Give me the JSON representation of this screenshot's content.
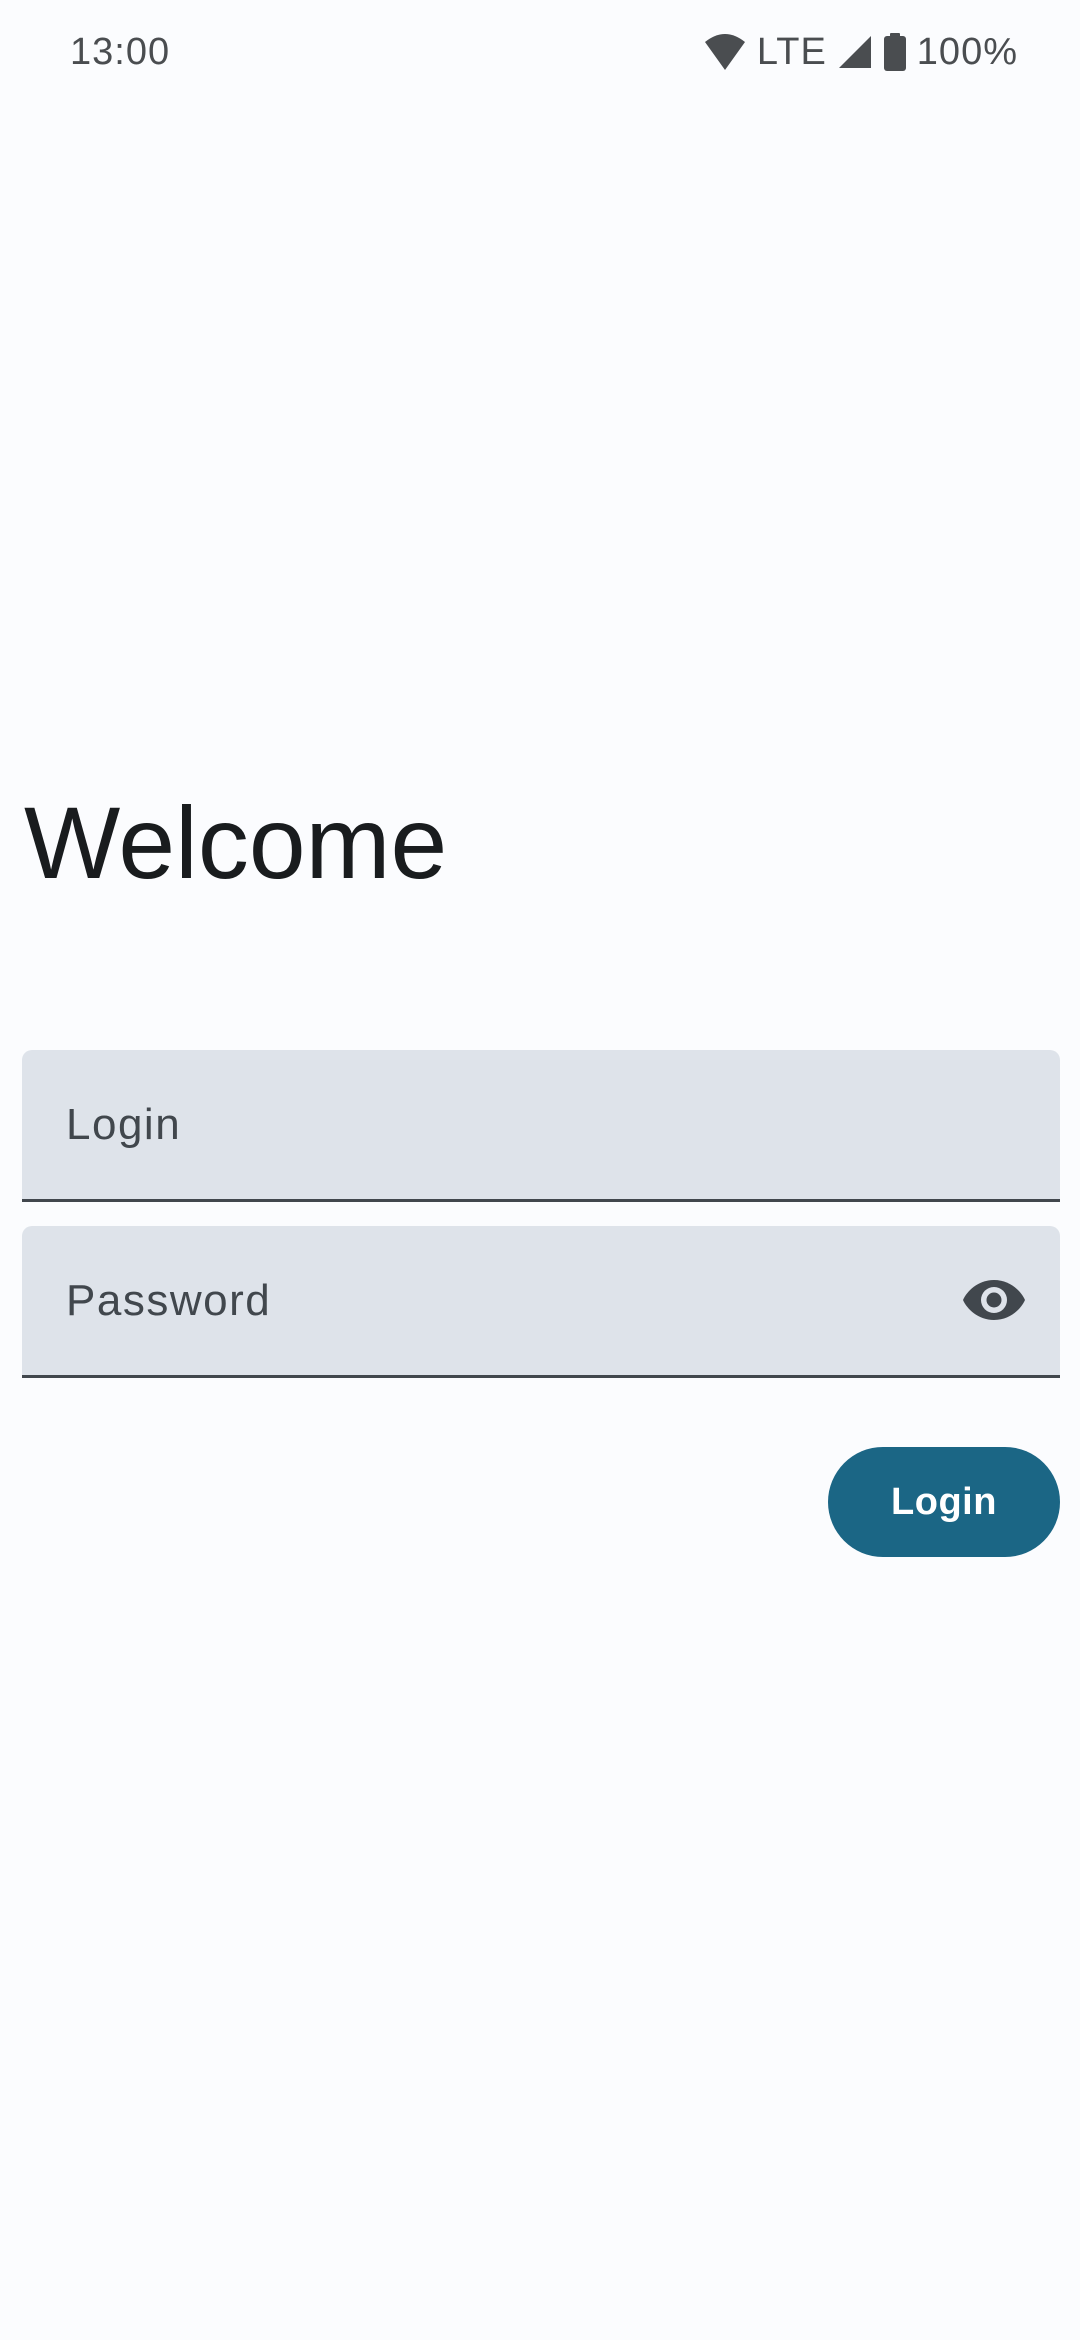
{
  "status_bar": {
    "time": "13:00",
    "network": "LTE",
    "battery": "100%",
    "icons": [
      "wifi-icon",
      "cell-signal-icon",
      "battery-icon"
    ]
  },
  "screen": {
    "title": "Welcome",
    "login_field": {
      "placeholder": "Login",
      "value": ""
    },
    "password_field": {
      "placeholder": "Password",
      "value": "",
      "toggle_icon": "eye-icon"
    },
    "login_button": {
      "label": "Login"
    }
  },
  "colors": {
    "background": "#fbfcfe",
    "field_background": "#dee3ea",
    "field_indicator": "#41474d",
    "primary": "#1b6685",
    "on_primary": "#ffffff",
    "text": "#191c1e",
    "status_icons": "#4a4d50"
  }
}
